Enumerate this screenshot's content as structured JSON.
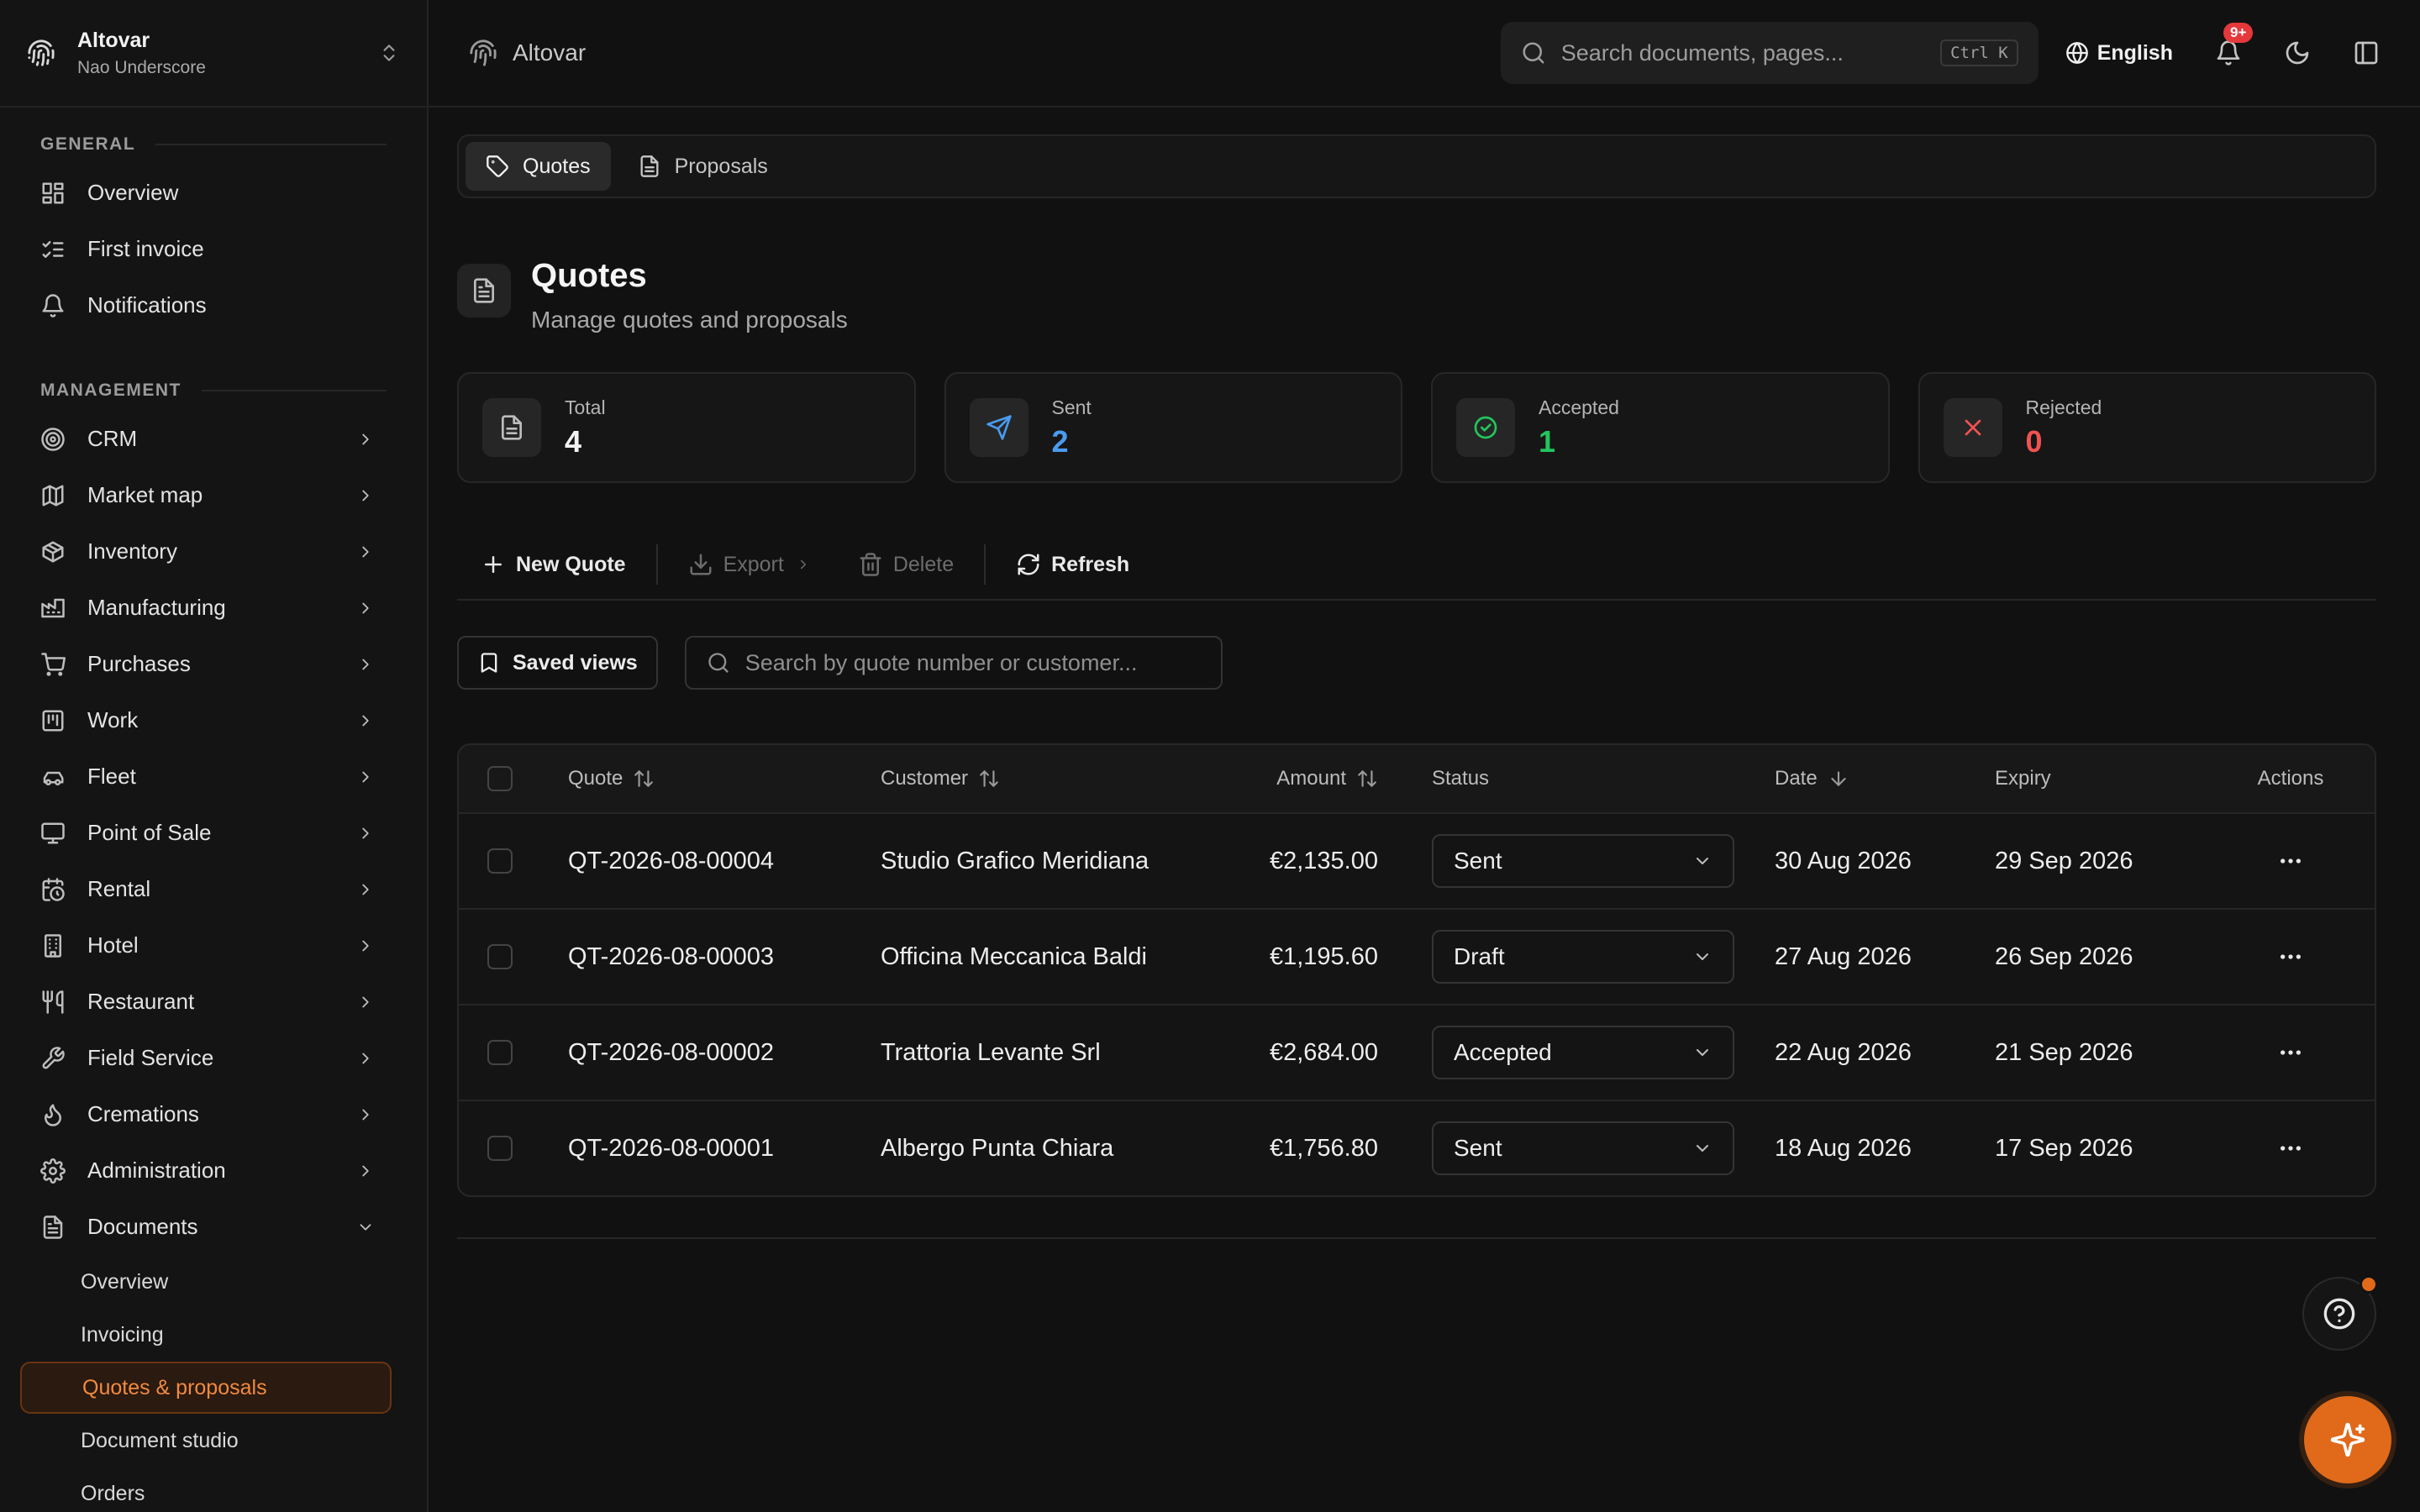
{
  "org": {
    "name": "Altovar",
    "subtitle": "Nao Underscore"
  },
  "sidebar": {
    "general_heading": "GENERAL",
    "general": [
      {
        "label": "Overview",
        "icon": "layout-grid-icon"
      },
      {
        "label": "First invoice",
        "icon": "checklist-icon"
      },
      {
        "label": "Notifications",
        "icon": "bell-icon"
      }
    ],
    "management_heading": "MANAGEMENT",
    "management": [
      {
        "label": "CRM",
        "icon": "target-icon"
      },
      {
        "label": "Market map",
        "icon": "map-icon"
      },
      {
        "label": "Inventory",
        "icon": "package-icon"
      },
      {
        "label": "Manufacturing",
        "icon": "factory-icon"
      },
      {
        "label": "Purchases",
        "icon": "cart-icon"
      },
      {
        "label": "Work",
        "icon": "kanban-icon"
      },
      {
        "label": "Fleet",
        "icon": "car-icon"
      },
      {
        "label": "Point of Sale",
        "icon": "monitor-icon"
      },
      {
        "label": "Rental",
        "icon": "calendar-clock-icon"
      },
      {
        "label": "Hotel",
        "icon": "building-icon"
      },
      {
        "label": "Restaurant",
        "icon": "utensils-icon"
      },
      {
        "label": "Field Service",
        "icon": "wrench-icon"
      },
      {
        "label": "Cremations",
        "icon": "flame-icon"
      },
      {
        "label": "Administration",
        "icon": "gear-icon"
      },
      {
        "label": "Documents",
        "icon": "file-icon"
      }
    ],
    "documents_sub": [
      {
        "label": "Overview"
      },
      {
        "label": "Invoicing"
      },
      {
        "label": "Quotes & proposals",
        "active": true
      },
      {
        "label": "Document studio"
      },
      {
        "label": "Orders"
      }
    ]
  },
  "topbar": {
    "app_name": "Altovar",
    "search_placeholder": "Search documents, pages...",
    "shortcut": "Ctrl K",
    "language": "English",
    "notif_badge": "9+"
  },
  "tabs": [
    {
      "label": "Quotes",
      "active": true
    },
    {
      "label": "Proposals"
    }
  ],
  "page": {
    "title": "Quotes",
    "subtitle": "Manage quotes and proposals"
  },
  "stats": [
    {
      "label": "Total",
      "value": "4",
      "color": "#f2f2f2"
    },
    {
      "label": "Sent",
      "value": "2",
      "color": "#4a9bf0"
    },
    {
      "label": "Accepted",
      "value": "1",
      "color": "#22c55e"
    },
    {
      "label": "Rejected",
      "value": "0",
      "color": "#f05252"
    }
  ],
  "toolbar": {
    "new_quote": "New Quote",
    "export": "Export",
    "delete": "Delete",
    "refresh": "Refresh"
  },
  "filters": {
    "saved_views": "Saved views",
    "search_placeholder": "Search by quote number or customer..."
  },
  "table": {
    "columns": [
      "Quote",
      "Customer",
      "Amount",
      "Status",
      "Date",
      "Expiry",
      "Actions"
    ],
    "rows": [
      {
        "quote": "QT-2026-08-00004",
        "customer": "Studio Grafico Meridiana",
        "amount": "€2,135.00",
        "status": "Sent",
        "date": "30 Aug 2026",
        "expiry": "29 Sep 2026"
      },
      {
        "quote": "QT-2026-08-00003",
        "customer": "Officina Meccanica Baldi",
        "amount": "€1,195.60",
        "status": "Draft",
        "date": "27 Aug 2026",
        "expiry": "26 Sep 2026"
      },
      {
        "quote": "QT-2026-08-00002",
        "customer": "Trattoria Levante Srl",
        "amount": "€2,684.00",
        "status": "Accepted",
        "date": "22 Aug 2026",
        "expiry": "21 Sep 2026"
      },
      {
        "quote": "QT-2026-08-00001",
        "customer": "Albergo Punta Chiara",
        "amount": "€1,756.80",
        "status": "Sent",
        "date": "18 Aug 2026",
        "expiry": "17 Sep 2026"
      }
    ]
  },
  "accent_color": "#e06a1a"
}
